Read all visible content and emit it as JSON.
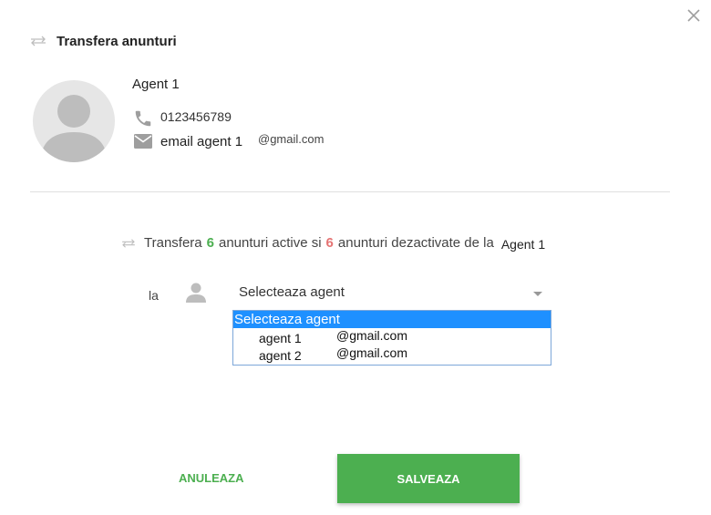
{
  "dialog": {
    "title": "Transfera anunturi",
    "close_icon": "close-icon"
  },
  "source_agent": {
    "name": "Agent 1",
    "phone": "0123456789",
    "email_local": "email agent 1",
    "email_domain": "@gmail.com"
  },
  "transfer": {
    "prefix": "Transfera",
    "active_count": "6",
    "active_label": "anunturi active si",
    "inactive_count": "6",
    "inactive_label": "anunturi dezactivate de la",
    "from_agent": "Agent 1",
    "active_color": "#4caf50",
    "inactive_color": "#e57373"
  },
  "target": {
    "la_label": "la",
    "select_value": "Selecteaza agent",
    "options": [
      {
        "label": "Selecteaza agent",
        "selected": true
      },
      {
        "name": "agent 1",
        "email": "@gmail.com"
      },
      {
        "name": "agent 2",
        "email": "@gmail.com"
      }
    ]
  },
  "actions": {
    "cancel_label": "ANULEAZA",
    "save_label": "SALVEAZA",
    "accent_color": "#4caf50"
  }
}
